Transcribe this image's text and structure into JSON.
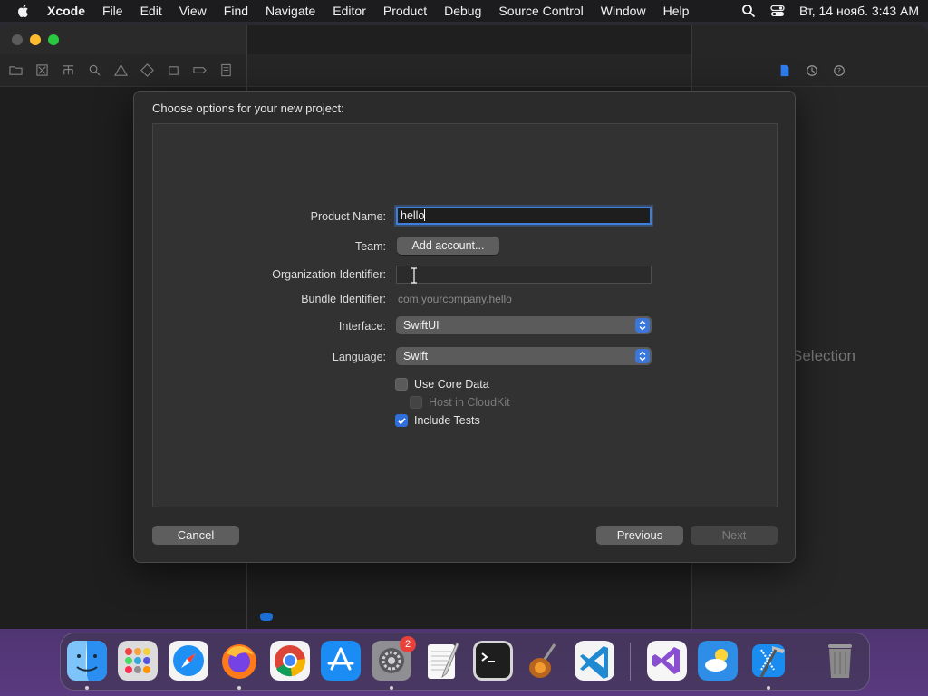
{
  "menubar": {
    "app_name": "Xcode",
    "items": [
      "File",
      "Edit",
      "View",
      "Find",
      "Navigate",
      "Editor",
      "Product",
      "Debug",
      "Source Control",
      "Window",
      "Help"
    ],
    "clock": "Вт, 14 нояб. 3:43 AM"
  },
  "inspector": {
    "empty_text": "Selection"
  },
  "dialog": {
    "title": "Choose options for your new project:",
    "product_name_label": "Product Name:",
    "product_name_value": "hello",
    "team_label": "Team:",
    "team_button": "Add account...",
    "org_id_label": "Organization Identifier:",
    "org_id_value": "",
    "bundle_id_label": "Bundle Identifier:",
    "bundle_id_value": "com.yourcompany.hello",
    "interface_label": "Interface:",
    "interface_value": "SwiftUI",
    "language_label": "Language:",
    "language_value": "Swift",
    "use_core_data_label": "Use Core Data",
    "use_core_data_checked": false,
    "host_in_cloudkit_label": "Host in CloudKit",
    "host_in_cloudkit_checked": false,
    "include_tests_label": "Include Tests",
    "include_tests_checked": true,
    "cancel_button": "Cancel",
    "previous_button": "Previous",
    "next_button": "Next"
  },
  "dock": {
    "apps": [
      {
        "name": "Finder",
        "icon": "finder-icon",
        "running": true
      },
      {
        "name": "Launchpad",
        "icon": "launchpad-icon",
        "running": false
      },
      {
        "name": "Safari",
        "icon": "safari-icon",
        "running": false
      },
      {
        "name": "Firefox",
        "icon": "firefox-icon",
        "running": true
      },
      {
        "name": "Chrome",
        "icon": "chrome-icon",
        "running": false
      },
      {
        "name": "App Store",
        "icon": "app-store-icon",
        "running": false
      },
      {
        "name": "System Settings",
        "icon": "system-settings-icon",
        "running": true,
        "badge": "2"
      },
      {
        "name": "TextEdit",
        "icon": "textedit-icon",
        "running": false
      },
      {
        "name": "Terminal",
        "icon": "terminal-icon",
        "running": false
      },
      {
        "name": "Instruments",
        "icon": "instruments-icon",
        "running": false
      },
      {
        "name": "Visual Studio Code",
        "icon": "vscode-icon",
        "running": false
      },
      {
        "name": "Visual Studio",
        "icon": "visual-studio-icon",
        "running": false
      },
      {
        "name": "Weather",
        "icon": "weather-icon",
        "running": false
      },
      {
        "name": "Xcode",
        "icon": "xcode-icon",
        "running": true
      },
      {
        "name": "Trash",
        "icon": "trash-icon",
        "running": false
      }
    ]
  },
  "colors": {
    "accent": "#2f6fdc",
    "menubar_bg": "#1c1c1e",
    "sheet_bg": "#2b2b2b"
  }
}
